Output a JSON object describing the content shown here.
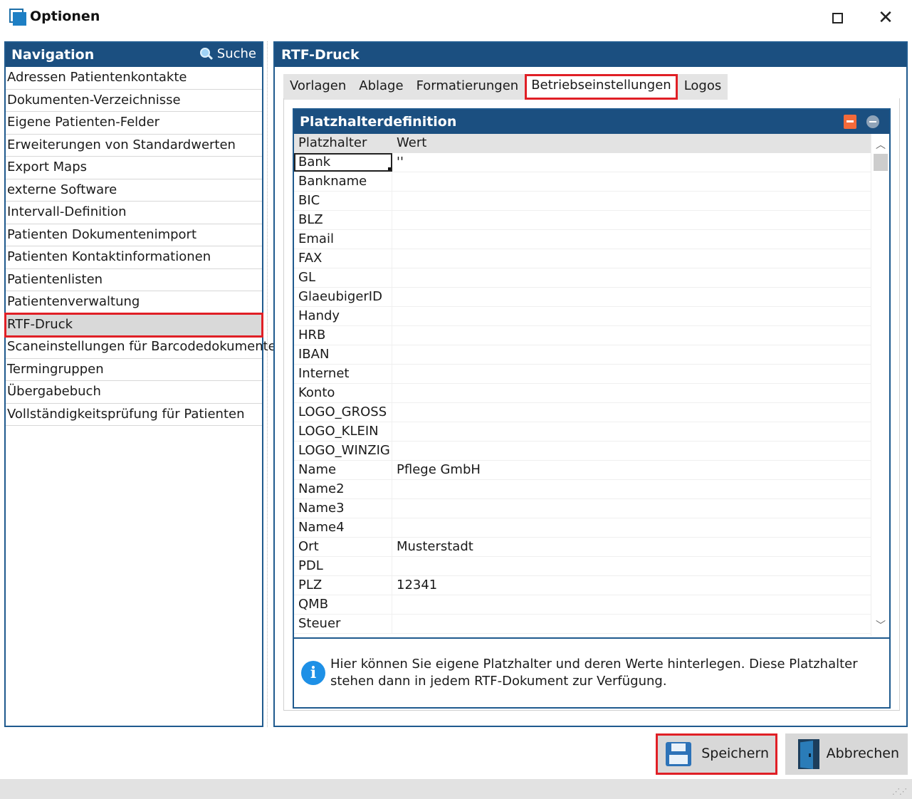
{
  "window": {
    "title": "Optionen",
    "maximize_icon": "maximize-icon",
    "close_icon": "close-icon",
    "close_glyph": "✕"
  },
  "navigation": {
    "title": "Navigation",
    "search_label": "Suche",
    "items": [
      {
        "label": "Adressen Patientenkontakte"
      },
      {
        "label": "Dokumenten-Verzeichnisse"
      },
      {
        "label": "Eigene Patienten-Felder"
      },
      {
        "label": "Erweiterungen von Standardwerten"
      },
      {
        "label": "Export Maps"
      },
      {
        "label": "externe Software"
      },
      {
        "label": "Intervall-Definition"
      },
      {
        "label": "Patienten Dokumentenimport"
      },
      {
        "label": "Patienten Kontaktinformationen"
      },
      {
        "label": "Patientenlisten"
      },
      {
        "label": "Patientenverwaltung"
      },
      {
        "label": "RTF-Druck",
        "selected": true
      },
      {
        "label": "Scaneinstellungen für Barcodedokumente"
      },
      {
        "label": "Termingruppen"
      },
      {
        "label": "Übergabebuch"
      },
      {
        "label": "Vollständigkeitsprüfung für Patienten"
      }
    ]
  },
  "main": {
    "title": "RTF-Druck",
    "tabs": [
      {
        "label": "Vorlagen"
      },
      {
        "label": "Ablage"
      },
      {
        "label": "Formatierungen"
      },
      {
        "label": "Betriebseinstellungen",
        "active": true
      },
      {
        "label": "Logos"
      }
    ],
    "group": {
      "title": "Platzhalterdefinition",
      "columns": [
        "Platzhalter",
        "Wert"
      ],
      "rows": [
        {
          "key": "Bank",
          "value": "''"
        },
        {
          "key": "Bankname",
          "value": ""
        },
        {
          "key": "BIC",
          "value": ""
        },
        {
          "key": "BLZ",
          "value": ""
        },
        {
          "key": "Email",
          "value": ""
        },
        {
          "key": "FAX",
          "value": ""
        },
        {
          "key": "GL",
          "value": ""
        },
        {
          "key": "GlaeubigerID",
          "value": ""
        },
        {
          "key": "Handy",
          "value": ""
        },
        {
          "key": "HRB",
          "value": ""
        },
        {
          "key": "IBAN",
          "value": ""
        },
        {
          "key": "Internet",
          "value": ""
        },
        {
          "key": "Konto",
          "value": ""
        },
        {
          "key": "LOGO_GROSS",
          "value": ""
        },
        {
          "key": "LOGO_KLEIN",
          "value": ""
        },
        {
          "key": "LOGO_WINZIG",
          "value": ""
        },
        {
          "key": "Name",
          "value": "Pflege GmbH"
        },
        {
          "key": "Name2",
          "value": ""
        },
        {
          "key": "Name3",
          "value": ""
        },
        {
          "key": "Name4",
          "value": ""
        },
        {
          "key": "Ort",
          "value": "Musterstadt"
        },
        {
          "key": "PDL",
          "value": ""
        },
        {
          "key": "PLZ",
          "value": "12341"
        },
        {
          "key": "QMB",
          "value": ""
        },
        {
          "key": "Steuer",
          "value": ""
        }
      ],
      "info_text": "Hier können Sie eigene Platzhalter und deren Werte hinterlegen. Diese Platzhalter stehen dann in jedem RTF-Dokument zur Verfügung.",
      "info_glyph": "i"
    }
  },
  "footer": {
    "save_label": "Speichern",
    "cancel_label": "Abbrechen"
  },
  "colors": {
    "header_blue": "#1b4f80",
    "highlight_red": "#e01f26",
    "info_blue": "#1e90e6"
  }
}
